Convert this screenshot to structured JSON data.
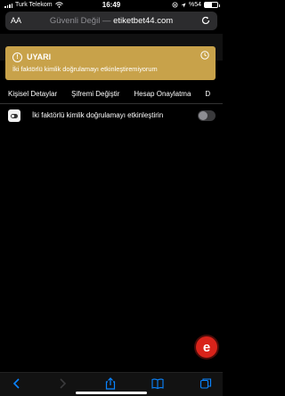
{
  "status_bar": {
    "carrier": "Turk Telekom",
    "time": "16:49",
    "battery": "%54",
    "battery_level": 0.54
  },
  "url_bar": {
    "text_size_label": "AA",
    "security": "Güvenli Değil",
    "separator": " — ",
    "domain": "etiketbet44.com"
  },
  "alert": {
    "icon": "!",
    "title": "UYARI",
    "message": "İki faktörlü kimlik doğrulamayı etkinleştiremiyorum",
    "color": "#c8a24a"
  },
  "tabs": [
    {
      "label": "Kişisel Detaylar"
    },
    {
      "label": "Şifremi Değiştir"
    },
    {
      "label": "Hesap Onaylatma"
    },
    {
      "label": "D"
    }
  ],
  "settings": {
    "two_factor_label": "İki faktörlü kimlik doğrulamayı etkinleştirin",
    "two_factor_enabled": false
  },
  "chat": {
    "label": "e",
    "color": "#d8231a"
  },
  "toolbar": {
    "items": [
      "back-icon",
      "forward-icon",
      "share-icon",
      "bookmarks-icon",
      "tabs-icon"
    ]
  }
}
